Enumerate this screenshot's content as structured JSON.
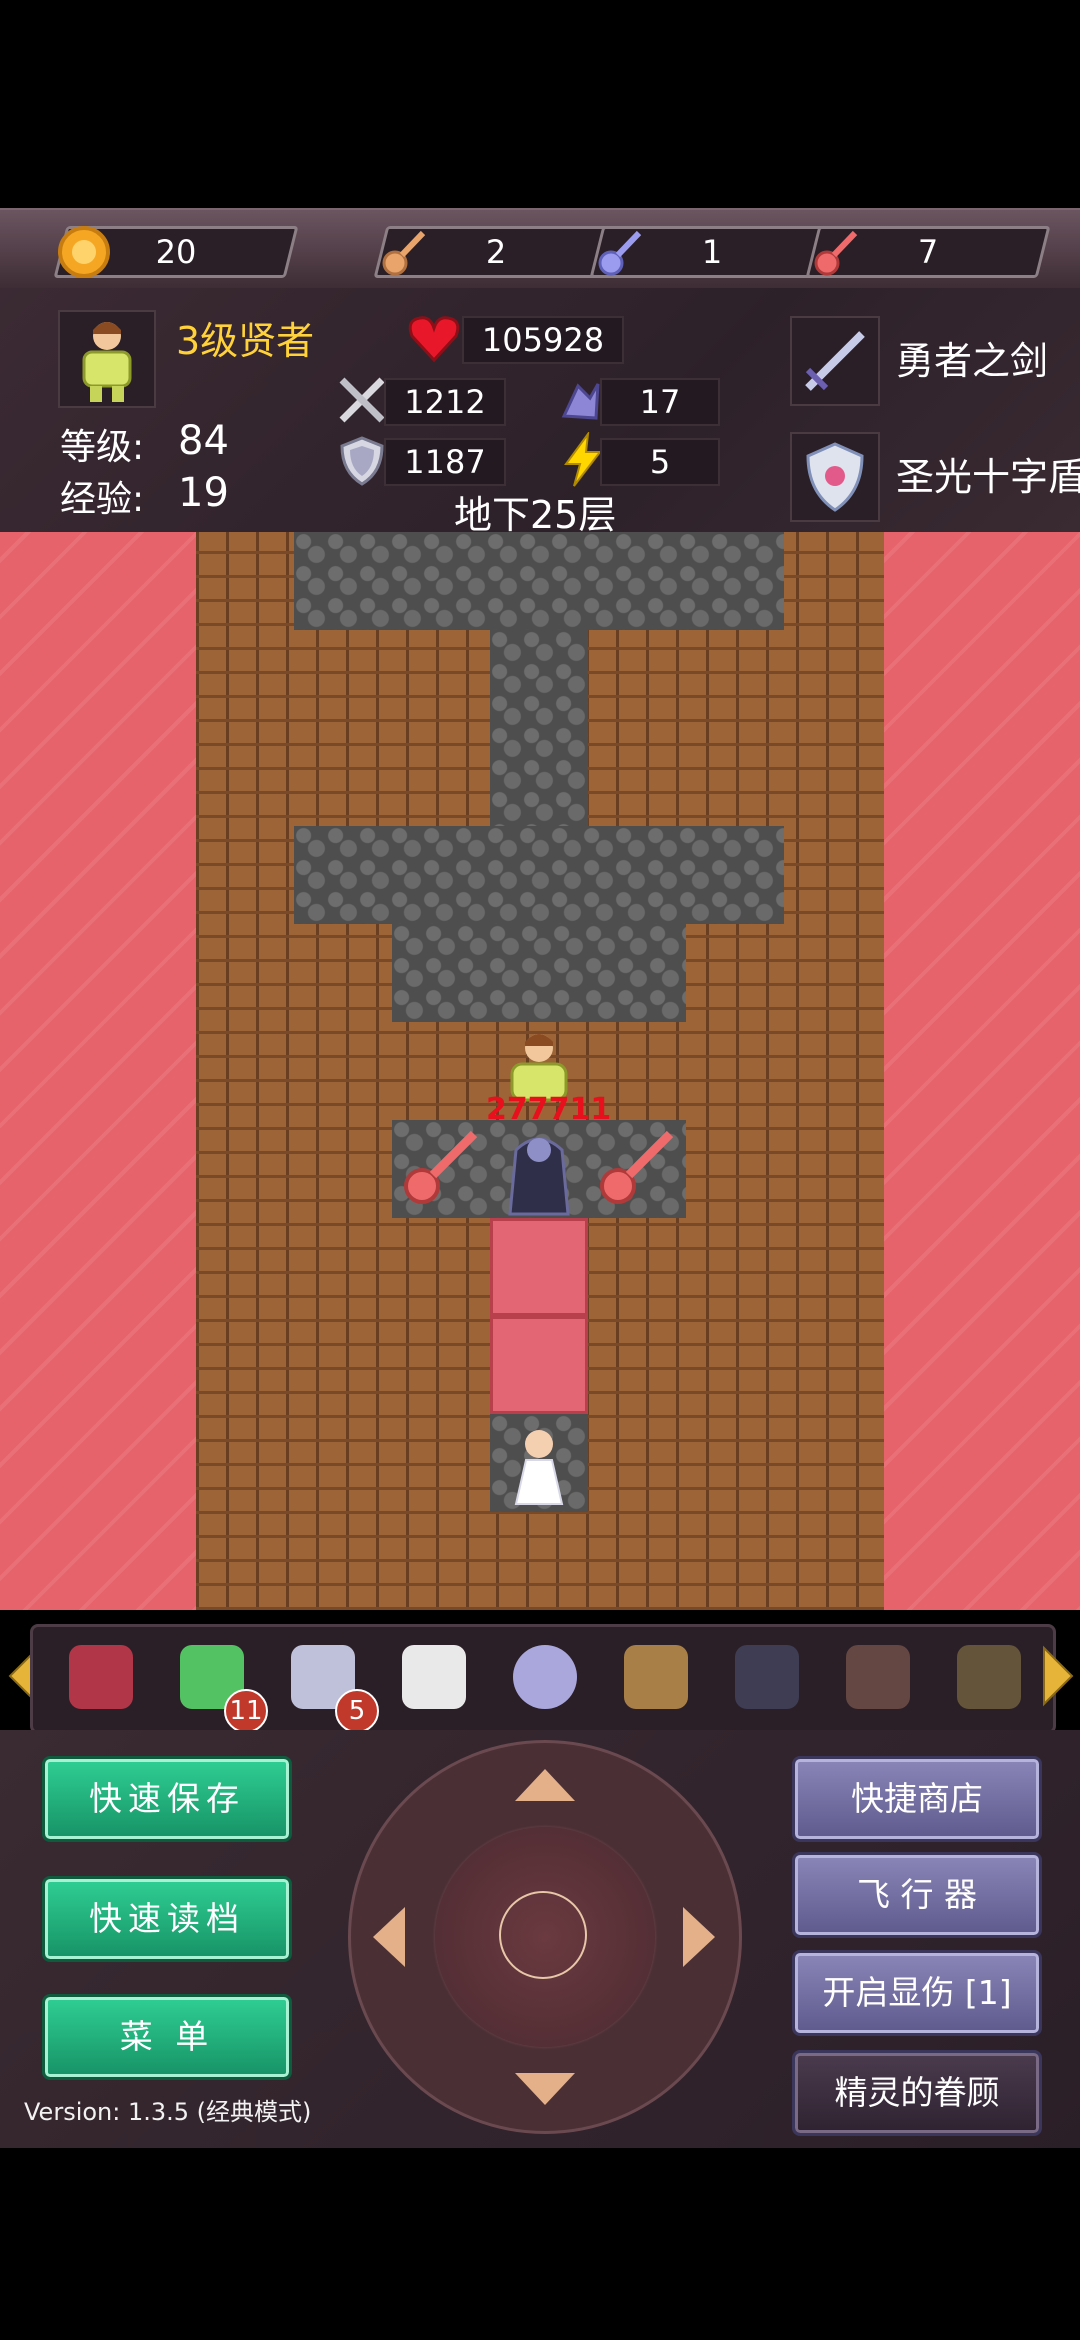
{
  "resources": {
    "coins": "20",
    "yellow_keys": "2",
    "blue_keys": "1",
    "red_keys": "7"
  },
  "hero": {
    "title": "3级贤者",
    "level_label": "等级:",
    "level": "84",
    "exp_label": "经验:",
    "exp": "19",
    "hp": "105928",
    "attack": "1212",
    "defense": "1187",
    "magic_defense": "17",
    "agility": "5"
  },
  "equipment": {
    "weapon": "勇者之剑",
    "shield": "圣光十字盾"
  },
  "floor": "地下25层",
  "battle": {
    "damage": "277711"
  },
  "items": [
    {
      "name": "monster-manual-icon",
      "count": ""
    },
    {
      "name": "green-potion-icon",
      "count": "11"
    },
    {
      "name": "holy-cross-icon",
      "count": "5"
    },
    {
      "name": "snowflake-icon",
      "count": ""
    },
    {
      "name": "crystal-orb-icon",
      "count": ""
    },
    {
      "name": "winged-staff-icon",
      "count": ""
    },
    {
      "name": "dark-vase-icon",
      "count": ""
    },
    {
      "name": "brown-vase-icon",
      "count": ""
    },
    {
      "name": "door-item-icon",
      "count": ""
    }
  ],
  "buttons": {
    "quick_save": "快速保存",
    "quick_load": "快速读档",
    "menu": "菜 单",
    "quick_shop": "快捷商店",
    "flyer": "飞 行 器",
    "show_damage": "开启显伤 [1]",
    "fairy_favor": "精灵的眷顾"
  },
  "version": "Version: 1.3.5 (经典模式)",
  "colors": {
    "lava": "#e6626a",
    "title_gold": "#ffd23a",
    "green_button": "#22b07c",
    "purple_button": "#7470a6"
  }
}
